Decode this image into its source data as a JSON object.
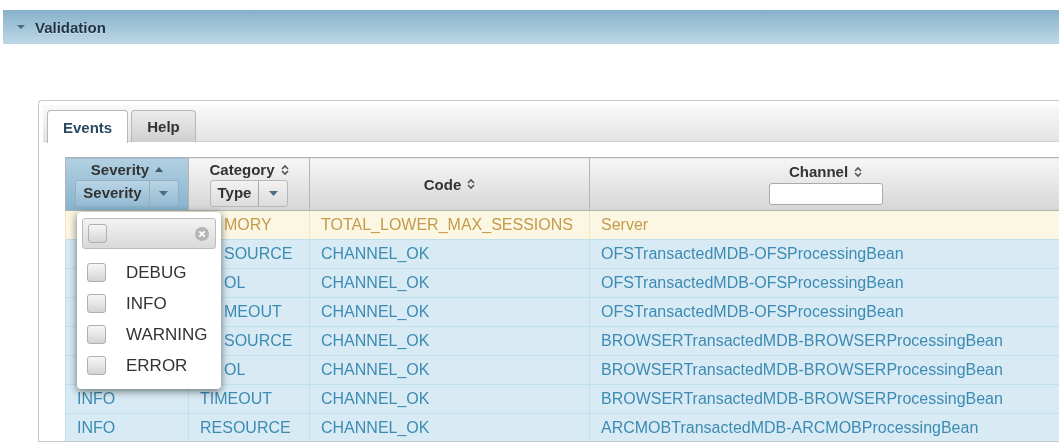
{
  "section": {
    "title": "Validation",
    "expanded": true
  },
  "tabs": [
    {
      "label": "Events",
      "selected": true
    },
    {
      "label": "Help",
      "selected": false
    }
  ],
  "table": {
    "columns": [
      {
        "label": "Severity",
        "sorted": true,
        "filter": {
          "kind": "select",
          "value": "Severity"
        }
      },
      {
        "label": "Category",
        "sorted": false,
        "filter": {
          "kind": "select",
          "value": "Type"
        }
      },
      {
        "label": "Code",
        "sorted": false,
        "filter": {
          "kind": "none"
        }
      },
      {
        "label": "Channel",
        "sorted": false,
        "filter": {
          "kind": "text"
        }
      }
    ],
    "rows": [
      {
        "kind": "warning",
        "category": "MORY",
        "code": "TOTAL_LOWER_MAX_SESSIONS",
        "channel": "Server"
      },
      {
        "kind": "info",
        "category": "SOURCE",
        "code": "CHANNEL_OK",
        "channel": "OFSTransactedMDB-OFSProcessingBean"
      },
      {
        "kind": "info",
        "category": "OL",
        "code": "CHANNEL_OK",
        "channel": "OFSTransactedMDB-OFSProcessingBean"
      },
      {
        "kind": "info",
        "category": "MEOUT",
        "code": "CHANNEL_OK",
        "channel": "OFSTransactedMDB-OFSProcessingBean"
      },
      {
        "kind": "info",
        "category": "SOURCE",
        "code": "CHANNEL_OK",
        "channel": "BROWSERTransactedMDB-BROWSERProcessingBean"
      },
      {
        "kind": "info",
        "category": "OL",
        "code": "CHANNEL_OK",
        "channel": "BROWSERTransactedMDB-BROWSERProcessingBean"
      },
      {
        "kind": "info",
        "severity": "INFO",
        "category": "TIMEOUT",
        "code": "CHANNEL_OK",
        "channel": "BROWSERTransactedMDB-BROWSERProcessingBean"
      },
      {
        "kind": "info",
        "severity": "INFO",
        "category": "RESOURCE",
        "code": "CHANNEL_OK",
        "channel": "ARCMOBTransactedMDB-ARCMOBProcessingBean"
      }
    ]
  },
  "filter_menu": {
    "all_checked": false,
    "options": [
      {
        "label": "DEBUG",
        "checked": false
      },
      {
        "label": "INFO",
        "checked": false
      },
      {
        "label": "WARNING",
        "checked": false
      },
      {
        "label": "ERROR",
        "checked": false
      }
    ]
  }
}
